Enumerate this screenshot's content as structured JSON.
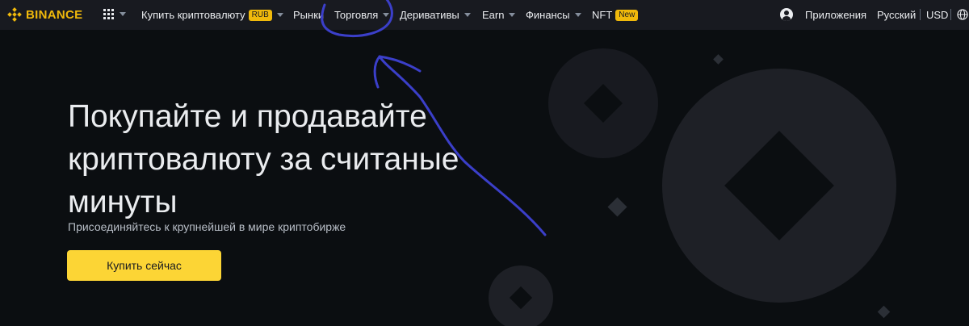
{
  "header": {
    "logo_text": "BINANCE",
    "nav": [
      {
        "label": "Купить криптовалюту",
        "badge": "RUB",
        "has_caret": true
      },
      {
        "label": "Рынки",
        "has_caret": false
      },
      {
        "label": "Торговля",
        "has_caret": true
      },
      {
        "label": "Деривативы",
        "has_caret": true
      },
      {
        "label": "Earn",
        "has_caret": true
      },
      {
        "label": "Финансы",
        "has_caret": true
      },
      {
        "label": "NFT",
        "badge": "New",
        "has_caret": false
      }
    ],
    "right": {
      "apps": "Приложения",
      "language": "Русский",
      "currency": "USD"
    }
  },
  "hero": {
    "title_line1": "Покупайте и продавайте",
    "title_line2": "криптовалюту за считаные",
    "title_line3": "минуты",
    "subtitle": "Присоединяйтесь к крупнейшей в мире криптобирже",
    "cta_label": "Купить сейчас"
  },
  "colors": {
    "brand": "#f0b90b",
    "cta": "#fcd535",
    "header_bg": "#181a20",
    "page_bg": "#0b0e11",
    "annotation": "#3b3fc9"
  },
  "icons": [
    "binance-logo-icon",
    "apps-grid-icon",
    "user-icon",
    "download-icon",
    "globe-icon"
  ]
}
